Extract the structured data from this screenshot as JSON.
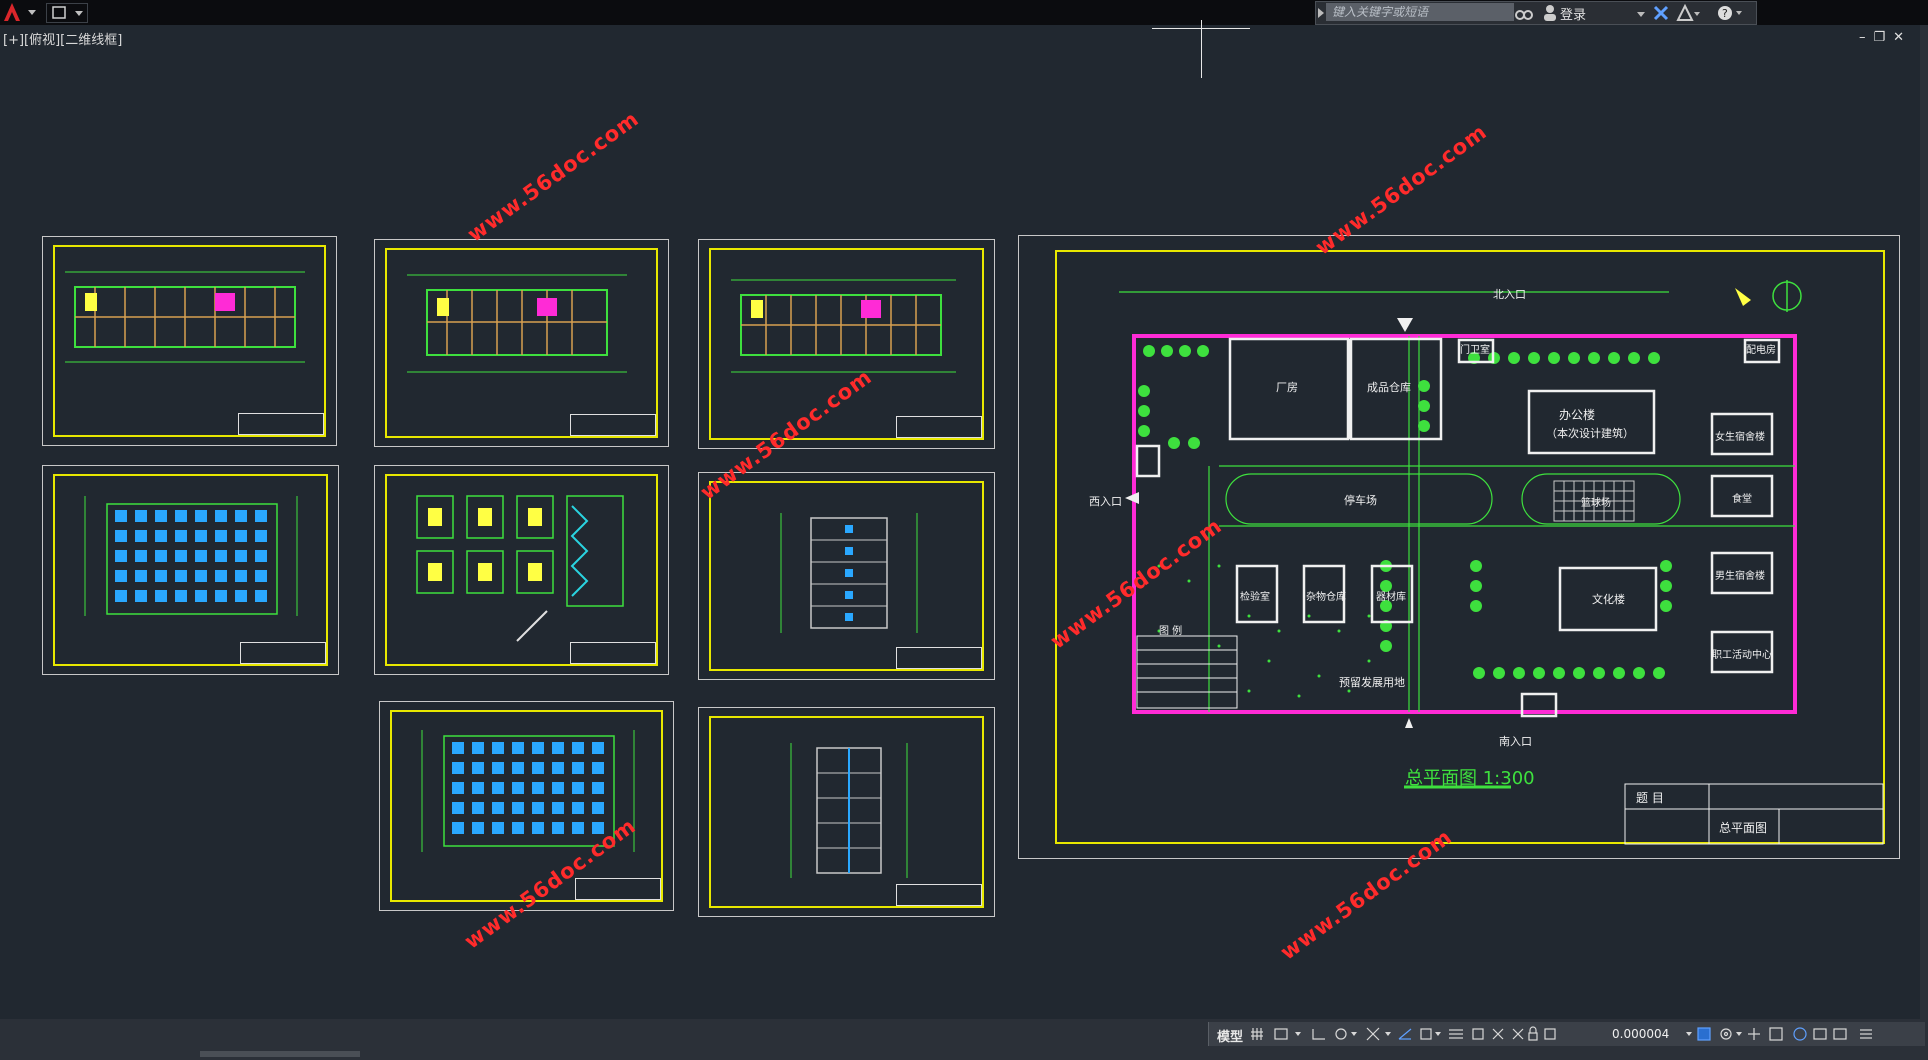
{
  "app": {
    "search_placeholder": "键入关键字或短语",
    "login_label": "登录"
  },
  "viewport": {
    "label": "[+][俯视][二维线框]"
  },
  "watermark": "www.56doc.com",
  "site_plan": {
    "north_entrance": "北入口",
    "west_entrance": "西入口",
    "south_entrance": "南入口",
    "gate_house": "门卫室",
    "power_room": "配电房",
    "factory": "厂房",
    "finished_warehouse": "成品仓库",
    "office_building": "办公楼",
    "office_note": "（本次设计建筑）",
    "playground": "停车场",
    "court": "篮球场",
    "lab": "检验室",
    "misc_warehouse": "杂物仓库",
    "material_warehouse": "器材库",
    "culture_building": "文化楼",
    "female_dorm": "女生宿舍楼",
    "canteen": "食堂",
    "male_dorm": "男生宿舍楼",
    "activity_center": "职工活动中心",
    "reserve_land": "预留发展用地",
    "legend_title": "图 例",
    "title": "总平面图 1:300",
    "titleblock_label": "题 目",
    "titleblock_name": "总平面图"
  },
  "status": {
    "model_tab": "模型",
    "coordinate": "0.000004"
  }
}
